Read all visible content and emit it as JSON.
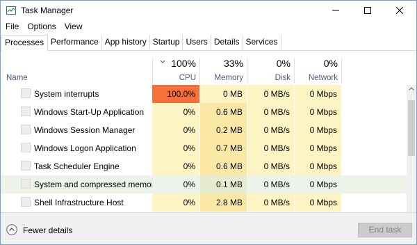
{
  "window": {
    "title": "Task Manager",
    "icon": "task-manager-icon",
    "controls": {
      "minimize": "minimize-icon",
      "maximize": "maximize-icon",
      "close": "close-icon"
    }
  },
  "menu": [
    "File",
    "Options",
    "View"
  ],
  "tabs": [
    "Processes",
    "Performance",
    "App history",
    "Startup",
    "Users",
    "Details",
    "Services"
  ],
  "active_tab": "Processes",
  "columns": {
    "name": "Name",
    "cpu": {
      "pct": "100%",
      "label": "CPU"
    },
    "memory": {
      "pct": "33%",
      "label": "Memory"
    },
    "disk": {
      "pct": "0%",
      "label": "Disk"
    },
    "network": {
      "pct": "0%",
      "label": "Network"
    }
  },
  "colors": {
    "cpu_high": "#f5703a",
    "heat_light": "#fdf4c4",
    "heat_medium": "#fbe8a4",
    "row_highlight": "#eef3ea"
  },
  "processes": [
    {
      "name": "System interrupts",
      "cpu": "100.0%",
      "memory": "0 MB",
      "disk": "0 MB/s",
      "network": "0 Mbps"
    },
    {
      "name": "Windows Start-Up Application",
      "cpu": "0%",
      "memory": "0.6 MB",
      "disk": "0 MB/s",
      "network": "0 Mbps"
    },
    {
      "name": "Windows Session Manager",
      "cpu": "0%",
      "memory": "0.2 MB",
      "disk": "0 MB/s",
      "network": "0 Mbps"
    },
    {
      "name": "Windows Logon Application",
      "cpu": "0%",
      "memory": "0.7 MB",
      "disk": "0 MB/s",
      "network": "0 Mbps"
    },
    {
      "name": "Task Scheduler Engine",
      "cpu": "0%",
      "memory": "0.6 MB",
      "disk": "0 MB/s",
      "network": "0 Mbps"
    },
    {
      "name": "System and compressed memory",
      "cpu": "0%",
      "memory": "0.1 MB",
      "disk": "0 MB/s",
      "network": "0 Mbps"
    },
    {
      "name": "Shell Infrastructure Host",
      "cpu": "0%",
      "memory": "2.8 MB",
      "disk": "0 MB/s",
      "network": "0 Mbps"
    }
  ],
  "footer": {
    "fewer_details": "Fewer details",
    "end_task": "End task"
  }
}
